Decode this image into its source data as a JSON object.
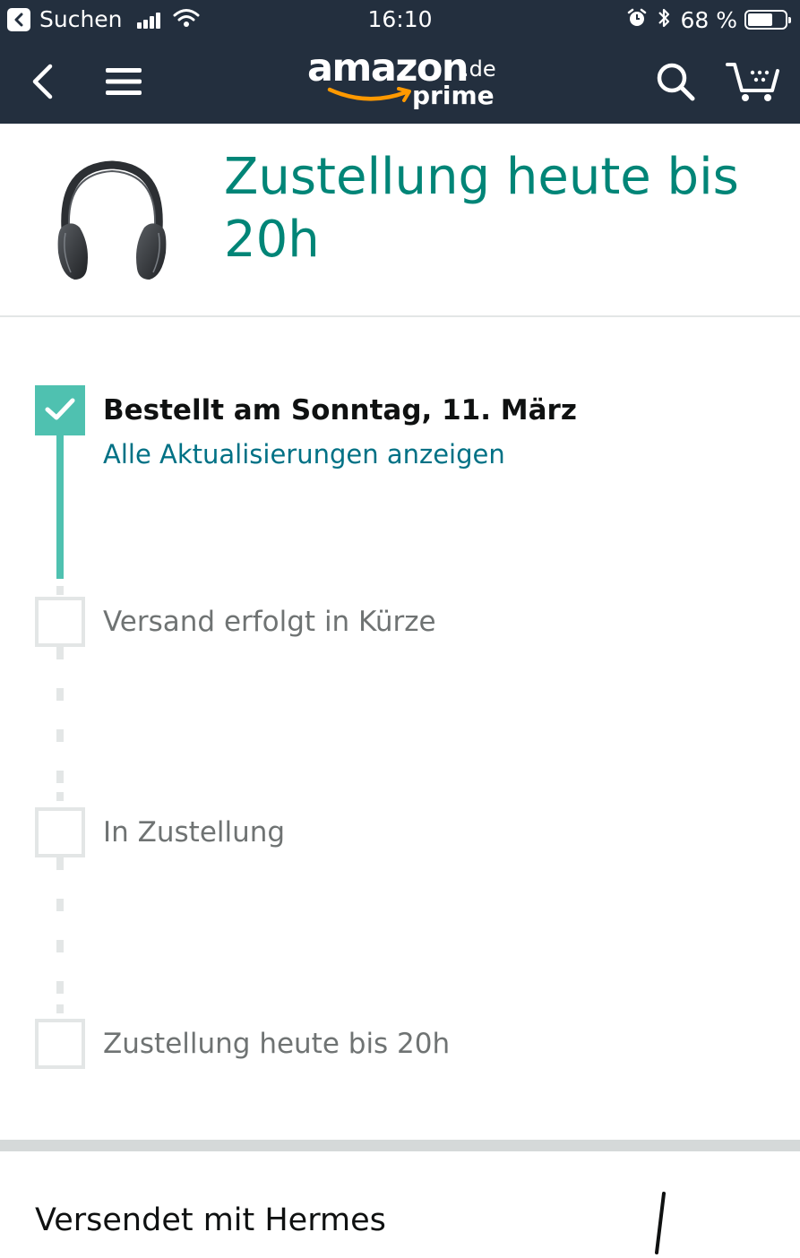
{
  "status_bar": {
    "back_app_label": "Suchen",
    "time": "16:10",
    "battery_percent_text": "68 %",
    "battery_level": 0.68
  },
  "nav": {
    "logo_text": "amazon",
    "logo_domain": ".de",
    "logo_sub": "prime",
    "icons": [
      "back-chevron-icon",
      "menu-icon",
      "search-icon",
      "cart-icon"
    ]
  },
  "product": {
    "delivery_title": "Zustellung heute bis 20h",
    "image_icon": "headphones-image"
  },
  "tracking": {
    "steps": [
      {
        "label": "Bestellt am Sonntag, 11. März",
        "link": "Alle Aktualisierungen anzeigen",
        "done": true
      },
      {
        "label": "Versand erfolgt in Kürze",
        "done": false
      },
      {
        "label": "In Zustellung",
        "done": false
      },
      {
        "label": "Zustellung heute bis 20h",
        "done": false
      }
    ]
  },
  "carrier": {
    "text": "Versendet mit Hermes"
  },
  "colors": {
    "nav_bg": "#232f3e",
    "title_teal": "#008577",
    "progress_teal": "#4fc1b0",
    "link_blue": "#007185",
    "inactive_gray": "#e3e6e6",
    "amazon_orange": "#ff9900"
  }
}
